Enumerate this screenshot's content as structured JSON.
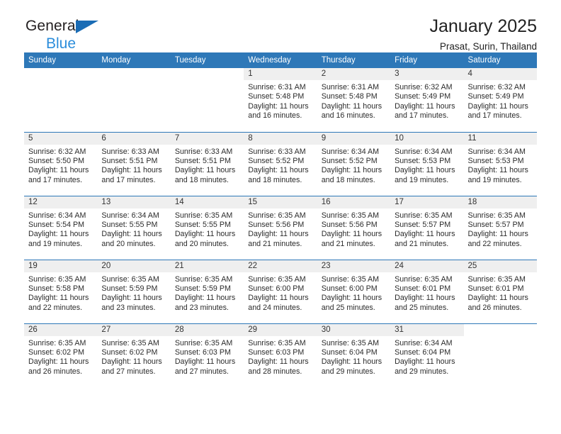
{
  "brand": {
    "name_part1": "General",
    "name_part2": "Blue"
  },
  "header": {
    "title": "January 2025",
    "location": "Prasat, Surin, Thailand"
  },
  "colors": {
    "header_blue": "#2e78b8",
    "brand_blue": "#2b8ddb",
    "daynum_band": "#efefef"
  },
  "weekday_headers": [
    "Sunday",
    "Monday",
    "Tuesday",
    "Wednesday",
    "Thursday",
    "Friday",
    "Saturday"
  ],
  "weeks": [
    [
      {
        "day": "",
        "blank": true
      },
      {
        "day": "",
        "blank": true
      },
      {
        "day": "",
        "blank": true
      },
      {
        "day": "1",
        "sunrise": "Sunrise: 6:31 AM",
        "sunset": "Sunset: 5:48 PM",
        "daylight_line1": "Daylight: 11 hours",
        "daylight_line2": "and 16 minutes."
      },
      {
        "day": "2",
        "sunrise": "Sunrise: 6:31 AM",
        "sunset": "Sunset: 5:48 PM",
        "daylight_line1": "Daylight: 11 hours",
        "daylight_line2": "and 16 minutes."
      },
      {
        "day": "3",
        "sunrise": "Sunrise: 6:32 AM",
        "sunset": "Sunset: 5:49 PM",
        "daylight_line1": "Daylight: 11 hours",
        "daylight_line2": "and 17 minutes."
      },
      {
        "day": "4",
        "sunrise": "Sunrise: 6:32 AM",
        "sunset": "Sunset: 5:49 PM",
        "daylight_line1": "Daylight: 11 hours",
        "daylight_line2": "and 17 minutes."
      }
    ],
    [
      {
        "day": "5",
        "sunrise": "Sunrise: 6:32 AM",
        "sunset": "Sunset: 5:50 PM",
        "daylight_line1": "Daylight: 11 hours",
        "daylight_line2": "and 17 minutes."
      },
      {
        "day": "6",
        "sunrise": "Sunrise: 6:33 AM",
        "sunset": "Sunset: 5:51 PM",
        "daylight_line1": "Daylight: 11 hours",
        "daylight_line2": "and 17 minutes."
      },
      {
        "day": "7",
        "sunrise": "Sunrise: 6:33 AM",
        "sunset": "Sunset: 5:51 PM",
        "daylight_line1": "Daylight: 11 hours",
        "daylight_line2": "and 18 minutes."
      },
      {
        "day": "8",
        "sunrise": "Sunrise: 6:33 AM",
        "sunset": "Sunset: 5:52 PM",
        "daylight_line1": "Daylight: 11 hours",
        "daylight_line2": "and 18 minutes."
      },
      {
        "day": "9",
        "sunrise": "Sunrise: 6:34 AM",
        "sunset": "Sunset: 5:52 PM",
        "daylight_line1": "Daylight: 11 hours",
        "daylight_line2": "and 18 minutes."
      },
      {
        "day": "10",
        "sunrise": "Sunrise: 6:34 AM",
        "sunset": "Sunset: 5:53 PM",
        "daylight_line1": "Daylight: 11 hours",
        "daylight_line2": "and 19 minutes."
      },
      {
        "day": "11",
        "sunrise": "Sunrise: 6:34 AM",
        "sunset": "Sunset: 5:53 PM",
        "daylight_line1": "Daylight: 11 hours",
        "daylight_line2": "and 19 minutes."
      }
    ],
    [
      {
        "day": "12",
        "sunrise": "Sunrise: 6:34 AM",
        "sunset": "Sunset: 5:54 PM",
        "daylight_line1": "Daylight: 11 hours",
        "daylight_line2": "and 19 minutes."
      },
      {
        "day": "13",
        "sunrise": "Sunrise: 6:34 AM",
        "sunset": "Sunset: 5:55 PM",
        "daylight_line1": "Daylight: 11 hours",
        "daylight_line2": "and 20 minutes."
      },
      {
        "day": "14",
        "sunrise": "Sunrise: 6:35 AM",
        "sunset": "Sunset: 5:55 PM",
        "daylight_line1": "Daylight: 11 hours",
        "daylight_line2": "and 20 minutes."
      },
      {
        "day": "15",
        "sunrise": "Sunrise: 6:35 AM",
        "sunset": "Sunset: 5:56 PM",
        "daylight_line1": "Daylight: 11 hours",
        "daylight_line2": "and 21 minutes."
      },
      {
        "day": "16",
        "sunrise": "Sunrise: 6:35 AM",
        "sunset": "Sunset: 5:56 PM",
        "daylight_line1": "Daylight: 11 hours",
        "daylight_line2": "and 21 minutes."
      },
      {
        "day": "17",
        "sunrise": "Sunrise: 6:35 AM",
        "sunset": "Sunset: 5:57 PM",
        "daylight_line1": "Daylight: 11 hours",
        "daylight_line2": "and 21 minutes."
      },
      {
        "day": "18",
        "sunrise": "Sunrise: 6:35 AM",
        "sunset": "Sunset: 5:57 PM",
        "daylight_line1": "Daylight: 11 hours",
        "daylight_line2": "and 22 minutes."
      }
    ],
    [
      {
        "day": "19",
        "sunrise": "Sunrise: 6:35 AM",
        "sunset": "Sunset: 5:58 PM",
        "daylight_line1": "Daylight: 11 hours",
        "daylight_line2": "and 22 minutes."
      },
      {
        "day": "20",
        "sunrise": "Sunrise: 6:35 AM",
        "sunset": "Sunset: 5:59 PM",
        "daylight_line1": "Daylight: 11 hours",
        "daylight_line2": "and 23 minutes."
      },
      {
        "day": "21",
        "sunrise": "Sunrise: 6:35 AM",
        "sunset": "Sunset: 5:59 PM",
        "daylight_line1": "Daylight: 11 hours",
        "daylight_line2": "and 23 minutes."
      },
      {
        "day": "22",
        "sunrise": "Sunrise: 6:35 AM",
        "sunset": "Sunset: 6:00 PM",
        "daylight_line1": "Daylight: 11 hours",
        "daylight_line2": "and 24 minutes."
      },
      {
        "day": "23",
        "sunrise": "Sunrise: 6:35 AM",
        "sunset": "Sunset: 6:00 PM",
        "daylight_line1": "Daylight: 11 hours",
        "daylight_line2": "and 25 minutes."
      },
      {
        "day": "24",
        "sunrise": "Sunrise: 6:35 AM",
        "sunset": "Sunset: 6:01 PM",
        "daylight_line1": "Daylight: 11 hours",
        "daylight_line2": "and 25 minutes."
      },
      {
        "day": "25",
        "sunrise": "Sunrise: 6:35 AM",
        "sunset": "Sunset: 6:01 PM",
        "daylight_line1": "Daylight: 11 hours",
        "daylight_line2": "and 26 minutes."
      }
    ],
    [
      {
        "day": "26",
        "sunrise": "Sunrise: 6:35 AM",
        "sunset": "Sunset: 6:02 PM",
        "daylight_line1": "Daylight: 11 hours",
        "daylight_line2": "and 26 minutes."
      },
      {
        "day": "27",
        "sunrise": "Sunrise: 6:35 AM",
        "sunset": "Sunset: 6:02 PM",
        "daylight_line1": "Daylight: 11 hours",
        "daylight_line2": "and 27 minutes."
      },
      {
        "day": "28",
        "sunrise": "Sunrise: 6:35 AM",
        "sunset": "Sunset: 6:03 PM",
        "daylight_line1": "Daylight: 11 hours",
        "daylight_line2": "and 27 minutes."
      },
      {
        "day": "29",
        "sunrise": "Sunrise: 6:35 AM",
        "sunset": "Sunset: 6:03 PM",
        "daylight_line1": "Daylight: 11 hours",
        "daylight_line2": "and 28 minutes."
      },
      {
        "day": "30",
        "sunrise": "Sunrise: 6:35 AM",
        "sunset": "Sunset: 6:04 PM",
        "daylight_line1": "Daylight: 11 hours",
        "daylight_line2": "and 29 minutes."
      },
      {
        "day": "31",
        "sunrise": "Sunrise: 6:34 AM",
        "sunset": "Sunset: 6:04 PM",
        "daylight_line1": "Daylight: 11 hours",
        "daylight_line2": "and 29 minutes."
      },
      {
        "day": "",
        "blank": true
      }
    ]
  ]
}
